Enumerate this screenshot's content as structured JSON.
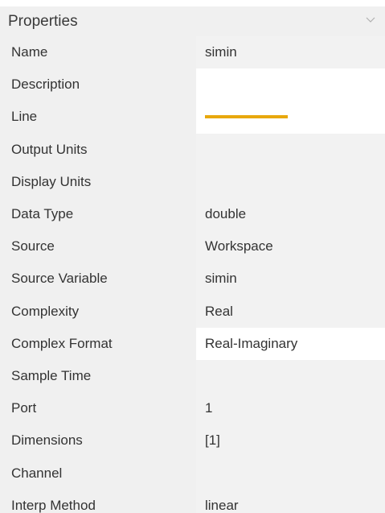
{
  "panel": {
    "title": "Properties",
    "collapse_icon": "chevron-down-icon"
  },
  "properties": [
    {
      "key": "name",
      "label": "Name",
      "value": "simin",
      "editable": false
    },
    {
      "key": "description",
      "label": "Description",
      "value": "",
      "editable": true
    },
    {
      "key": "line",
      "label": "Line",
      "value": "",
      "editable": true,
      "swatch_color": "#e8a80c"
    },
    {
      "key": "output-units",
      "label": "Output Units",
      "value": "",
      "editable": false
    },
    {
      "key": "display-units",
      "label": "Display Units",
      "value": "",
      "editable": false
    },
    {
      "key": "data-type",
      "label": "Data Type",
      "value": "double",
      "editable": false
    },
    {
      "key": "source",
      "label": "Source",
      "value": "Workspace",
      "editable": false
    },
    {
      "key": "source-variable",
      "label": "Source Variable",
      "value": "simin",
      "editable": false
    },
    {
      "key": "complexity",
      "label": "Complexity",
      "value": "Real",
      "editable": false
    },
    {
      "key": "complex-format",
      "label": "Complex Format",
      "value": "Real-Imaginary",
      "editable": true
    },
    {
      "key": "sample-time",
      "label": "Sample Time",
      "value": "",
      "editable": false
    },
    {
      "key": "port",
      "label": "Port",
      "value": "1",
      "editable": false
    },
    {
      "key": "dimensions",
      "label": "Dimensions",
      "value": "[1]",
      "editable": false
    },
    {
      "key": "channel",
      "label": "Channel",
      "value": "",
      "editable": false
    },
    {
      "key": "interp-method",
      "label": "Interp Method",
      "value": "linear",
      "editable": false
    }
  ]
}
